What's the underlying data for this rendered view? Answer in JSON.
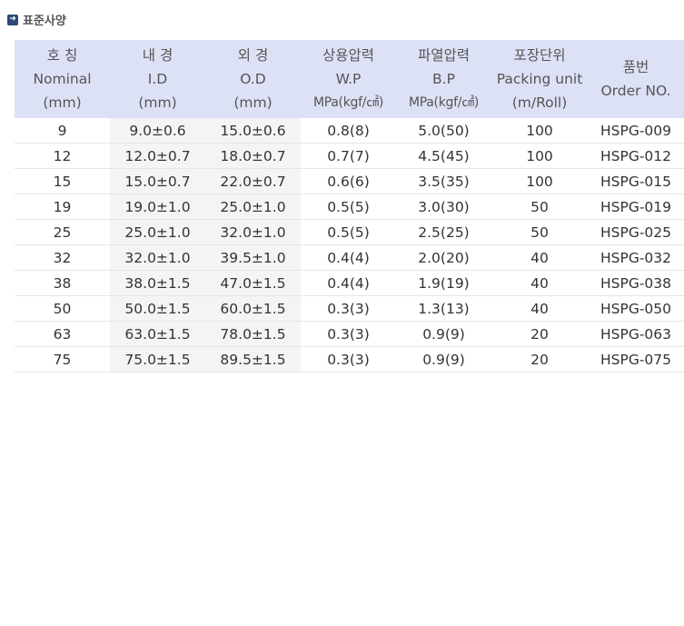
{
  "section": {
    "icon": "arrow-right-box-icon",
    "title": "표준사양"
  },
  "table": {
    "headers": [
      {
        "ko": "호 칭",
        "en": "Nominal",
        "unit": "(mm)"
      },
      {
        "ko": "내 경",
        "en": "I.D",
        "unit": "(mm)"
      },
      {
        "ko": "외 경",
        "en": "O.D",
        "unit": "(mm)"
      },
      {
        "ko": "상용압력",
        "en": "W.P",
        "unit": "MPa(kgf/㎠)"
      },
      {
        "ko": "파열압력",
        "en": "B.P",
        "unit": "MPa(kgf/㎠)"
      },
      {
        "ko": "포장단위",
        "en": "Packing unit",
        "unit": "(m/Roll)"
      },
      {
        "ko": "품번",
        "en": "Order NO."
      }
    ],
    "rows": [
      [
        "9",
        "9.0±0.6",
        "15.0±0.6",
        "0.8(8)",
        "5.0(50)",
        "100",
        "HSPG-009"
      ],
      [
        "12",
        "12.0±0.7",
        "18.0±0.7",
        "0.7(7)",
        "4.5(45)",
        "100",
        "HSPG-012"
      ],
      [
        "15",
        "15.0±0.7",
        "22.0±0.7",
        "0.6(6)",
        "3.5(35)",
        "100",
        "HSPG-015"
      ],
      [
        "19",
        "19.0±1.0",
        "25.0±1.0",
        "0.5(5)",
        "3.0(30)",
        "50",
        "HSPG-019"
      ],
      [
        "25",
        "25.0±1.0",
        "32.0±1.0",
        "0.5(5)",
        "2.5(25)",
        "50",
        "HSPG-025"
      ],
      [
        "32",
        "32.0±1.0",
        "39.5±1.0",
        "0.4(4)",
        "2.0(20)",
        "40",
        "HSPG-032"
      ],
      [
        "38",
        "38.0±1.5",
        "47.0±1.5",
        "0.4(4)",
        "1.9(19)",
        "40",
        "HSPG-038"
      ],
      [
        "50",
        "50.0±1.5",
        "60.0±1.5",
        "0.3(3)",
        "1.3(13)",
        "40",
        "HSPG-050"
      ],
      [
        "63",
        "63.0±1.5",
        "78.0±1.5",
        "0.3(3)",
        "0.9(9)",
        "20",
        "HSPG-063"
      ],
      [
        "75",
        "75.0±1.5",
        "89.5±1.5",
        "0.3(3)",
        "0.9(9)",
        "20",
        "HSPG-075"
      ]
    ]
  },
  "colors": {
    "header_bg": "#dde1f5",
    "shaded_column_bg": "#f4f4f4",
    "icon_bg": "#2d4a78"
  }
}
